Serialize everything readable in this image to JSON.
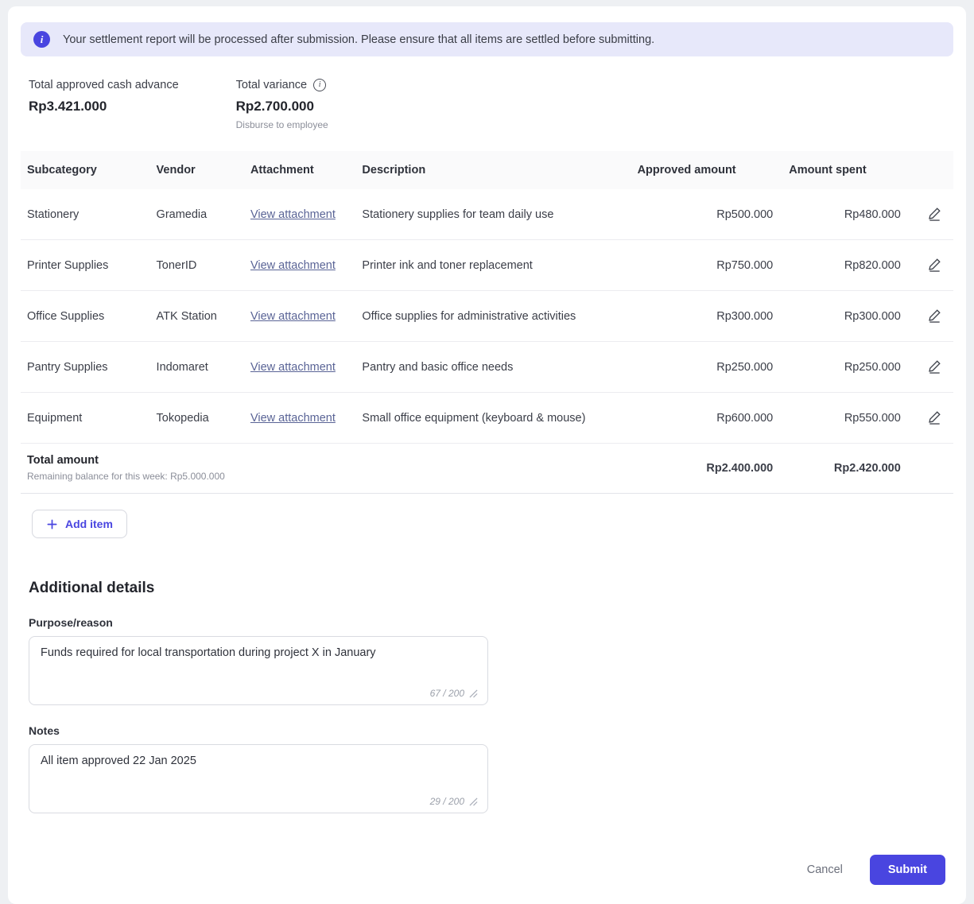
{
  "banner": {
    "text": "Your settlement report will be processed after submission. Please ensure that all items are settled before submitting."
  },
  "summary": {
    "approved_label": "Total approved cash advance",
    "approved_value": "Rp3.421.000",
    "variance_label": "Total variance",
    "variance_value": "Rp2.700.000",
    "variance_note": "Disburse to employee"
  },
  "table": {
    "headers": {
      "subcategory": "Subcategory",
      "vendor": "Vendor",
      "attachment": "Attachment",
      "description": "Description",
      "approved": "Approved amount",
      "spent": "Amount spent"
    },
    "attachment_link": "View attachment",
    "rows": [
      {
        "subcategory": "Stationery",
        "vendor": "Gramedia",
        "description": "Stationery supplies for team daily use",
        "approved": "Rp500.000",
        "spent": "Rp480.000"
      },
      {
        "subcategory": "Printer Supplies",
        "vendor": "TonerID",
        "description": "Printer ink and toner replacement",
        "approved": "Rp750.000",
        "spent": "Rp820.000"
      },
      {
        "subcategory": "Office Supplies",
        "vendor": "ATK Station",
        "description": "Office supplies for administrative activities",
        "approved": "Rp300.000",
        "spent": "Rp300.000"
      },
      {
        "subcategory": "Pantry Supplies",
        "vendor": "Indomaret",
        "description": "Pantry and basic office needs",
        "approved": "Rp250.000",
        "spent": "Rp250.000"
      },
      {
        "subcategory": "Equipment",
        "vendor": "Tokopedia",
        "description": "Small office equipment (keyboard & mouse)",
        "approved": "Rp600.000",
        "spent": "Rp550.000"
      }
    ],
    "total": {
      "label": "Total amount",
      "note": "Remaining balance for this week: Rp5.000.000",
      "approved": "Rp2.400.000",
      "spent": "Rp2.420.000"
    }
  },
  "actions": {
    "add_item": "Add item",
    "cancel": "Cancel",
    "submit": "Submit"
  },
  "additional": {
    "title": "Additional details",
    "purpose_label": "Purpose/reason",
    "purpose_value": "Funds required for local transportation during project X in January",
    "purpose_count": "67 / 200",
    "notes_label": "Notes",
    "notes_value": "All item approved 22 Jan 2025",
    "notes_count": "29 / 200"
  },
  "colors": {
    "accent": "#4945e0",
    "banner_bg": "#e7e8fa",
    "link": "#5a6496"
  }
}
